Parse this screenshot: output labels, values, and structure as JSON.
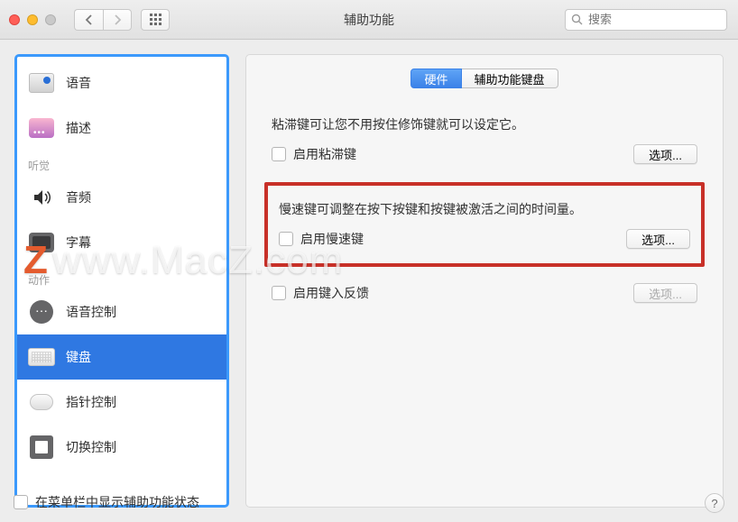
{
  "titlebar": {
    "title": "辅助功能",
    "search_placeholder": "搜索"
  },
  "sidebar": {
    "section_hearing": "听觉",
    "section_motor": "动作",
    "items": [
      {
        "label": "语音"
      },
      {
        "label": "描述"
      },
      {
        "label": "音频"
      },
      {
        "label": "字幕"
      },
      {
        "label": "语音控制"
      },
      {
        "label": "键盘"
      },
      {
        "label": "指针控制"
      },
      {
        "label": "切换控制"
      }
    ]
  },
  "tabs": {
    "hardware": "硬件",
    "acc_keyboard": "辅助功能键盘"
  },
  "sticky": {
    "desc": "粘滞键可让您不用按住修饰键就可以设定它。",
    "enable": "启用粘滞键",
    "options": "选项..."
  },
  "slow": {
    "desc": "慢速键可调整在按下按键和按键被激活之间的时间量。",
    "enable": "启用慢速键",
    "options": "选项..."
  },
  "feedback": {
    "enable": "启用键入反馈",
    "options": "选项..."
  },
  "footer": {
    "label": "在菜单栏中显示辅助功能状态"
  },
  "watermark": {
    "z": "Z",
    "text": "www.MacZ.com"
  }
}
